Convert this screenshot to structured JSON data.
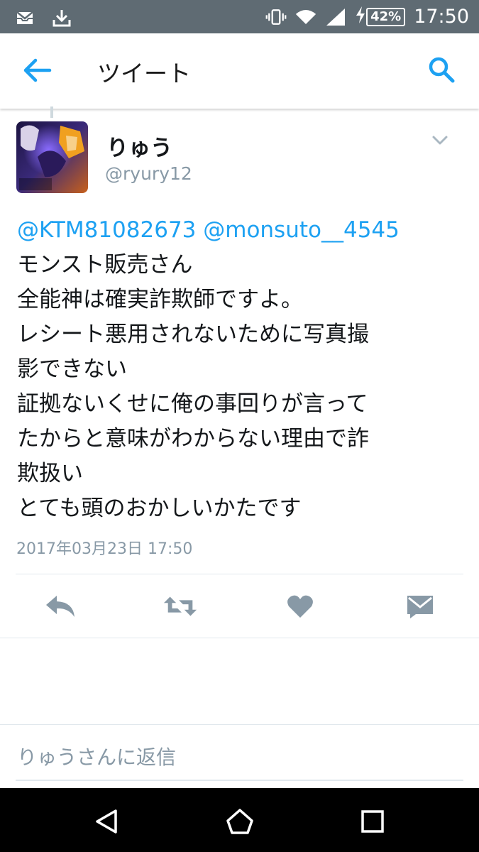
{
  "status_bar": {
    "battery": "42%",
    "time": "17:50",
    "icons": [
      "mail-icon",
      "download-icon",
      "vibrate-icon",
      "wifi-icon",
      "signal-icon",
      "charging-icon"
    ]
  },
  "app_bar": {
    "title": "ツイート",
    "back_icon": "arrow-left-icon",
    "search_icon": "search-icon",
    "accent": "#1da1f2"
  },
  "tweet": {
    "display_name": "りゅう",
    "handle": "@ryury12",
    "avatar_label": "りゅう",
    "mentions": "@KTM81082673 @monsuto__4545",
    "lines": [
      "モンスト販売さん",
      "全能神は確実詐欺師ですよ。",
      "レシート悪用されないために写真撮",
      "影できない",
      "証拠ないくせに俺の事回りが言って",
      "たからと意味がわからない理由で詐",
      "欺扱い",
      "とても頭のおかしいかたです"
    ],
    "timestamp": "2017年03月23日 17:50"
  },
  "actions": {
    "icons": [
      "reply-icon",
      "retweet-icon",
      "like-icon",
      "direct-message-icon"
    ],
    "icon_color": "#8899a6"
  },
  "reply": {
    "placeholder": "りゅうさんに返信"
  },
  "nav_bar": {
    "icons": [
      "nav-back-icon",
      "nav-home-icon",
      "nav-recents-icon"
    ]
  }
}
